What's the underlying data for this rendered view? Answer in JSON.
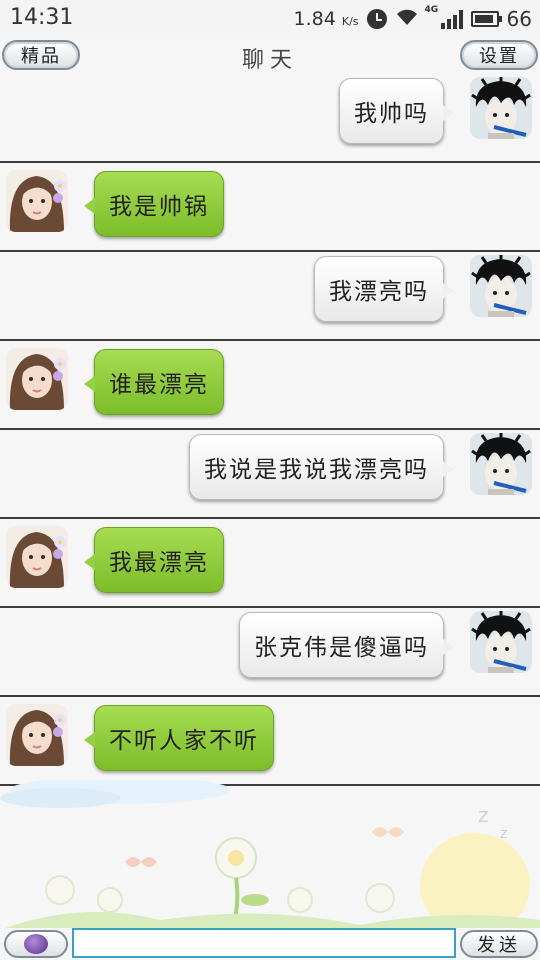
{
  "status_bar": {
    "time": "14:31",
    "speed": "1.84",
    "speed_unit": "K/s",
    "network_label": "4G",
    "battery": "66",
    "icons": [
      "alarm-icon",
      "wifi-icon",
      "signal-icon",
      "battery-icon"
    ]
  },
  "header": {
    "left_button": "精品",
    "title": "聊天",
    "right_button": "设置"
  },
  "messages": [
    {
      "sender": "me",
      "text": "我帅吗"
    },
    {
      "sender": "her",
      "text": "我是帅锅"
    },
    {
      "sender": "me",
      "text": "我漂亮吗"
    },
    {
      "sender": "her",
      "text": "谁最漂亮"
    },
    {
      "sender": "me",
      "text": "我说是我说我漂亮吗"
    },
    {
      "sender": "her",
      "text": "我最漂亮"
    },
    {
      "sender": "me",
      "text": "张克伟是傻逼吗"
    },
    {
      "sender": "her",
      "text": "不听人家不听"
    }
  ],
  "input_bar": {
    "voice_icon": "microphone-icon",
    "input_value": "",
    "send_label": "发送"
  },
  "colors": {
    "her_bubble": "#8fcc3d",
    "me_bubble": "#f2f2f2",
    "input_border": "#39a0c7",
    "divider": "#3c3c3c"
  }
}
